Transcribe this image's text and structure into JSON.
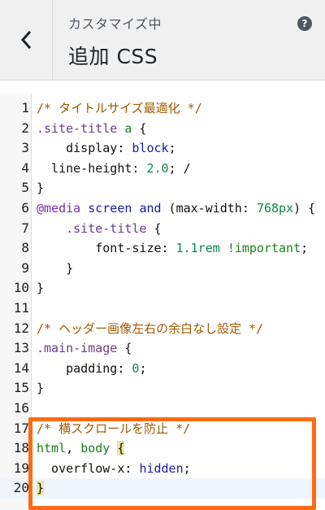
{
  "header": {
    "subtitle": "カスタマイズ中",
    "title": "追加 CSS",
    "back_icon": "chevron-left-icon",
    "help_icon": "help-icon",
    "help_glyph": "?"
  },
  "editor": {
    "lines": [
      {
        "num": "1",
        "tokens": [
          {
            "t": "comment",
            "v": "/* タイトルサイズ最適化 */"
          }
        ]
      },
      {
        "num": "2",
        "tokens": [
          {
            "t": "sel",
            "v": ".site-title "
          },
          {
            "t": "tag",
            "v": "a"
          },
          {
            "t": "punc",
            "v": " {"
          }
        ]
      },
      {
        "num": "3",
        "tokens": [
          {
            "t": "prop",
            "v": "    display"
          },
          {
            "t": "punc",
            "v": ": "
          },
          {
            "t": "val",
            "v": "block"
          },
          {
            "t": "punc",
            "v": ";"
          }
        ]
      },
      {
        "num": "4",
        "tokens": [
          {
            "t": "prop",
            "v": "  line-height"
          },
          {
            "t": "punc",
            "v": ": "
          },
          {
            "t": "num",
            "v": "2.0"
          },
          {
            "t": "punc",
            "v": "; /"
          }
        ]
      },
      {
        "num": "5",
        "tokens": [
          {
            "t": "punc",
            "v": "}"
          }
        ]
      },
      {
        "num": "6",
        "tokens": [
          {
            "t": "at",
            "v": "@media"
          },
          {
            "t": "punc",
            "v": " "
          },
          {
            "t": "val",
            "v": "screen"
          },
          {
            "t": "punc",
            "v": " "
          },
          {
            "t": "val",
            "v": "and"
          },
          {
            "t": "punc",
            "v": " (max-width: "
          },
          {
            "t": "num",
            "v": "768px"
          },
          {
            "t": "punc",
            "v": ") {"
          }
        ]
      },
      {
        "num": "7",
        "tokens": [
          {
            "t": "sel",
            "v": "    .site-title"
          },
          {
            "t": "punc",
            "v": " {"
          }
        ]
      },
      {
        "num": "8",
        "tokens": [
          {
            "t": "prop",
            "v": "        font-size"
          },
          {
            "t": "punc",
            "v": ": "
          },
          {
            "t": "num",
            "v": "1.1rem"
          },
          {
            "t": "punc",
            "v": " "
          },
          {
            "t": "imp",
            "v": "!important"
          },
          {
            "t": "punc",
            "v": ";"
          }
        ]
      },
      {
        "num": "9",
        "tokens": [
          {
            "t": "punc",
            "v": "    }"
          }
        ]
      },
      {
        "num": "10",
        "tokens": [
          {
            "t": "punc",
            "v": "}"
          }
        ]
      },
      {
        "num": "11",
        "tokens": []
      },
      {
        "num": "12",
        "tokens": [
          {
            "t": "comment",
            "v": "/* ヘッダー画像左右の余白なし設定 */"
          }
        ]
      },
      {
        "num": "13",
        "tokens": [
          {
            "t": "sel",
            "v": ".main-image"
          },
          {
            "t": "punc",
            "v": " {"
          }
        ]
      },
      {
        "num": "14",
        "tokens": [
          {
            "t": "prop",
            "v": "    padding"
          },
          {
            "t": "punc",
            "v": ": "
          },
          {
            "t": "num",
            "v": "0"
          },
          {
            "t": "punc",
            "v": ";"
          }
        ]
      },
      {
        "num": "15",
        "tokens": [
          {
            "t": "punc",
            "v": "}"
          }
        ]
      },
      {
        "num": "16",
        "tokens": []
      },
      {
        "num": "17",
        "tokens": [
          {
            "t": "comment",
            "v": "/* 横スクロールを防止 */"
          }
        ]
      },
      {
        "num": "18",
        "tokens": [
          {
            "t": "tag",
            "v": "html"
          },
          {
            "t": "punc",
            "v": ", "
          },
          {
            "t": "tag",
            "v": "body"
          },
          {
            "t": "punc",
            "v": " "
          },
          {
            "t": "match",
            "v": "{"
          }
        ]
      },
      {
        "num": "19",
        "tokens": [
          {
            "t": "prop",
            "v": "  overflow-x"
          },
          {
            "t": "punc",
            "v": ": "
          },
          {
            "t": "val",
            "v": "hidden"
          },
          {
            "t": "punc",
            "v": ";"
          }
        ]
      },
      {
        "num": "20",
        "tokens": [
          {
            "t": "match",
            "v": "}"
          }
        ]
      }
    ],
    "active_line": 20
  },
  "colors": {
    "highlight_border": "#ff6a13",
    "header_bg": "#f0f0f1",
    "comment": "#a05a00",
    "keyword_green": "#1a7f1a"
  }
}
